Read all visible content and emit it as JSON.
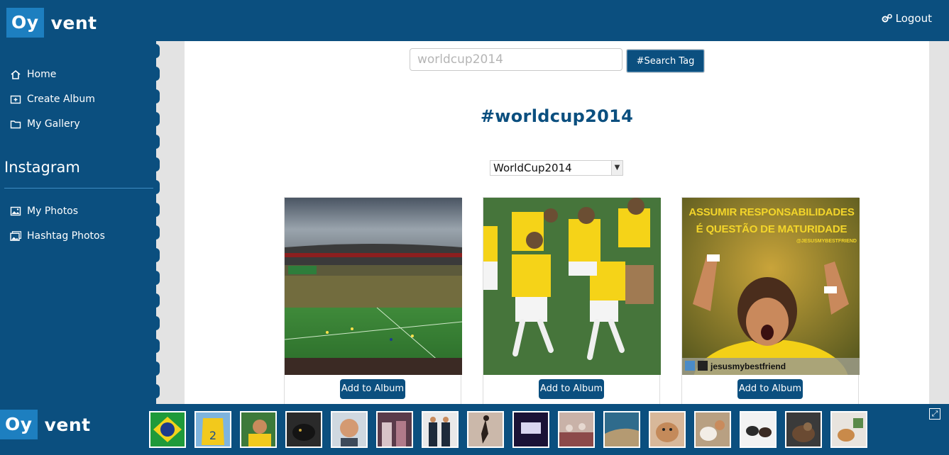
{
  "header": {
    "logo_box": "Oy",
    "logo_rest": "vent",
    "logout_label": "Logout"
  },
  "sidebar": {
    "items": [
      {
        "label": "Home",
        "icon": "home-icon"
      },
      {
        "label": "Create Album",
        "icon": "add-album-icon"
      },
      {
        "label": "My Gallery",
        "icon": "folder-icon"
      }
    ],
    "heading": "Instagram",
    "instagram_items": [
      {
        "label": "My Photos",
        "icon": "image-icon"
      },
      {
        "label": "Hashtag Photos",
        "icon": "images-icon"
      }
    ]
  },
  "search": {
    "value": "worldcup2014",
    "button_label": "#Search Tag"
  },
  "tag_title": "#worldcup2014",
  "album_select": {
    "selected": "WorldCup2014"
  },
  "cards": [
    {
      "button_label": "Add to Album"
    },
    {
      "button_label": "Add to Album"
    },
    {
      "button_label": "Add to Album",
      "caption_top": "ASSUMIR RESPONSABILIDADES",
      "caption_bottom": "É QUESTÃO DE MATURIDADE",
      "handle_small": "@JESUSMYBESTFRIEND",
      "repost_user": "jesusmybestfriend"
    }
  ],
  "footer": {
    "logo_box": "Oy",
    "logo_rest": "vent"
  },
  "colors": {
    "brand": "#0b4f7f",
    "logo_accent": "#1d7fc0",
    "strip": "#e3e3e3"
  }
}
